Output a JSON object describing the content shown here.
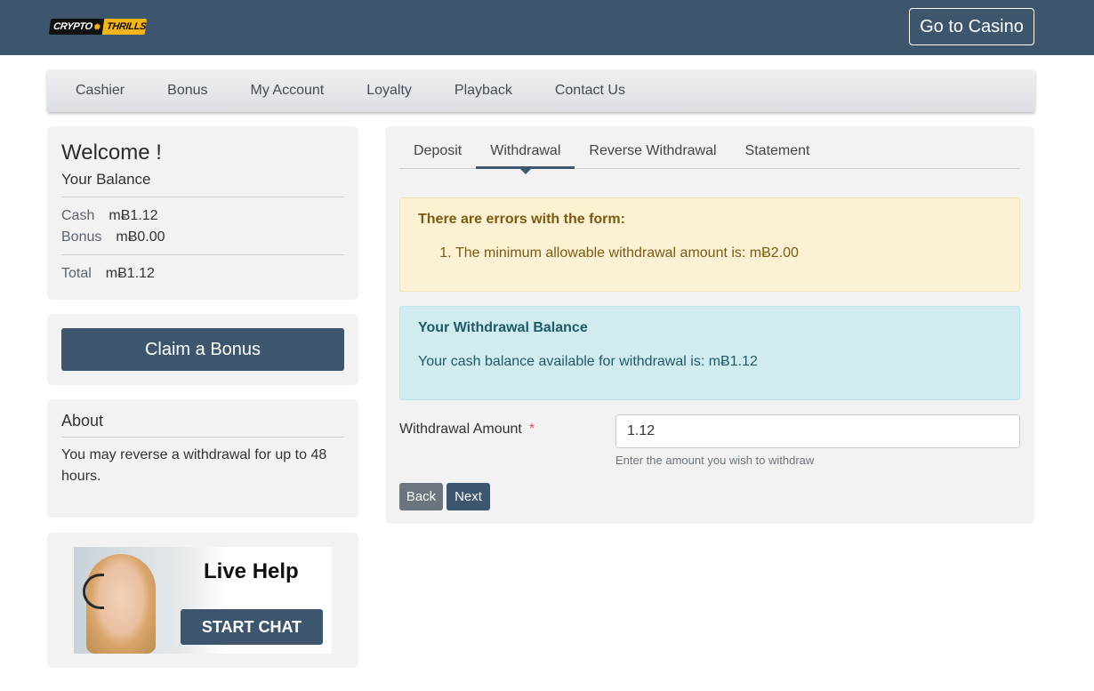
{
  "header": {
    "logo_part1": "CRYPTO",
    "logo_part2": "THRILLS",
    "casino_button": "Go to Casino"
  },
  "nav": {
    "items": [
      "Cashier",
      "Bonus",
      "My Account",
      "Loyalty",
      "Playback",
      "Contact Us"
    ]
  },
  "welcome": {
    "title": "Welcome !",
    "subtitle": "Your Balance",
    "cash_label": "Cash",
    "cash_value": "mɃ1.12",
    "bonus_label": "Bonus",
    "bonus_value": "mɃ0.00",
    "total_label": "Total",
    "total_value": "mɃ1.12"
  },
  "claim": {
    "label": "Claim a Bonus"
  },
  "about": {
    "title": "About",
    "text": "You may reverse a withdrawal for up to 48 hours."
  },
  "help": {
    "title": "Live Help",
    "button": "START CHAT"
  },
  "tabs": [
    "Deposit",
    "Withdrawal",
    "Reverse Withdrawal",
    "Statement"
  ],
  "active_tab": "Withdrawal",
  "error_alert": {
    "title": "There are errors with the form:",
    "items": [
      "The minimum allowable withdrawal amount is: mɃ2.00"
    ]
  },
  "info_alert": {
    "title": "Your Withdrawal Balance",
    "text": "Your cash balance available for withdrawal is: mɃ1.12"
  },
  "form": {
    "label": "Withdrawal Amount",
    "required_mark": "*",
    "value": "1.12",
    "hint": "Enter the amount you wish to withdraw",
    "back": "Back",
    "next": "Next"
  },
  "colors": {
    "primary": "#3d566e",
    "warning_bg": "#fcf1d3",
    "info_bg": "#d1ecf1",
    "required": "#d9534f"
  }
}
